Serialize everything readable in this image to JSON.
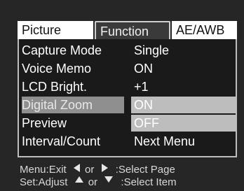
{
  "tabs": [
    {
      "label": "Picture",
      "active": false
    },
    {
      "label": "Function",
      "active": true
    },
    {
      "label": "AE/AWB",
      "active": false
    }
  ],
  "menu": {
    "rows": [
      {
        "label": "Capture Mode",
        "value": "Single"
      },
      {
        "label": "Voice Memo",
        "value": "ON"
      },
      {
        "label": "LCD Bright.",
        "value": "+1"
      },
      {
        "label": "Digital Zoom",
        "value": "ON",
        "selected": true
      },
      {
        "label": "Preview",
        "value": "OFF"
      },
      {
        "label": "Interval/Count",
        "value": "Next Menu"
      }
    ]
  },
  "footer": {
    "line1": {
      "prefix": "Menu:Exit",
      "or": "or",
      "action": ":Select Page",
      "icons": [
        "triangle-left-icon",
        "triangle-right-icon"
      ]
    },
    "line2": {
      "prefix": "Set:Adjust",
      "or": "or",
      "action": ":Select Item",
      "icons": [
        "triangle-up-icon",
        "triangle-down-icon"
      ]
    }
  },
  "colors": {
    "background": "#262626",
    "tab_inactive": "#ffffff",
    "selected_label": "#8f8f8f",
    "selected_value": "#bdbdbd"
  }
}
